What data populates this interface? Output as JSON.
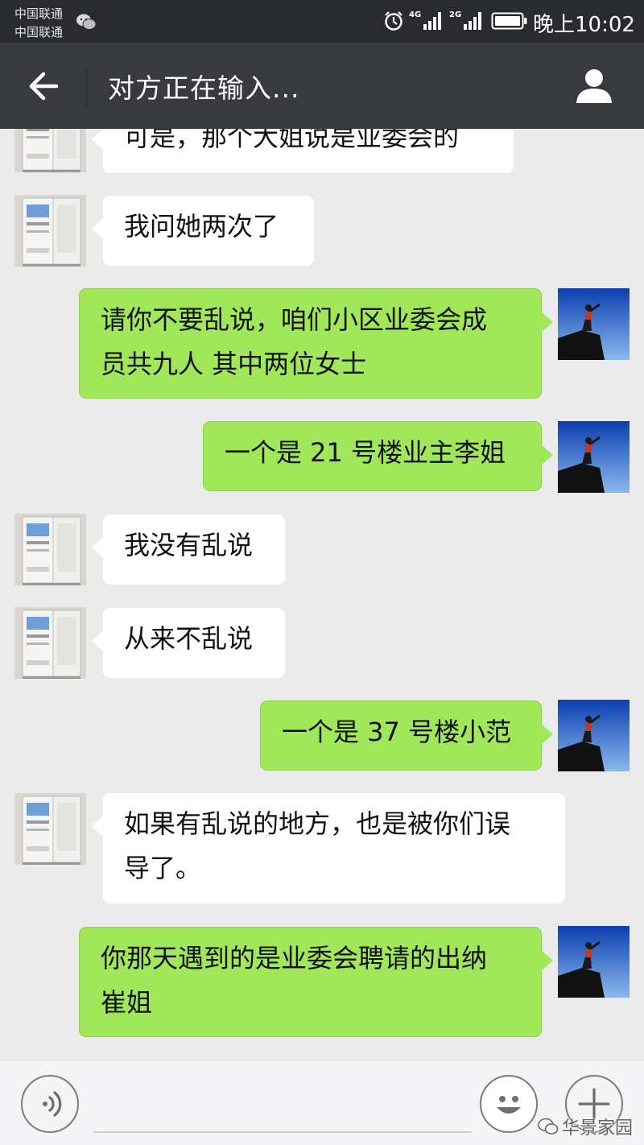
{
  "status_bar": {
    "carrier_1": "中国联通",
    "carrier_2": "中国联通",
    "network_1": "4G",
    "network_2": "2G",
    "time": "晚上10:02",
    "icons": [
      "wechat-icon",
      "alarm-icon",
      "signal-icon",
      "signal-icon",
      "battery-icon"
    ]
  },
  "nav": {
    "title": "对方正在输入...",
    "back_icon": "back-arrow-icon",
    "profile_icon": "person-icon"
  },
  "colors": {
    "status_bar": "#2a2b2f",
    "nav_bar": "#393a3e",
    "chat_background": "#ebebeb",
    "incoming_bubble": "#ffffff",
    "outgoing_bubble": "#a0e75a"
  },
  "contacts": {
    "other": {
      "avatar": "product-photo-avatar"
    },
    "me": {
      "avatar": "mountain-silhouette-avatar"
    }
  },
  "messages": [
    {
      "sender": "other",
      "lines": [
        "可是，那个大姐说是业委会的"
      ]
    },
    {
      "sender": "other",
      "lines": [
        "我问她两次了"
      ]
    },
    {
      "sender": "me",
      "lines": [
        "请你不要乱说，咱们小区业委会成",
        "员共九人 其中两位女士"
      ]
    },
    {
      "sender": "me",
      "lines": [
        "一个是 21 号楼业主李姐"
      ]
    },
    {
      "sender": "other",
      "lines": [
        "我没有乱说"
      ]
    },
    {
      "sender": "other",
      "lines": [
        "从来不乱说"
      ]
    },
    {
      "sender": "me",
      "lines": [
        "一个是 37 号楼小范"
      ]
    },
    {
      "sender": "other",
      "lines": [
        "如果有乱说的地方，也是被你们误",
        "导了。"
      ]
    },
    {
      "sender": "me",
      "lines": [
        "你那天遇到的是业委会聘请的出纳",
        "崔姐"
      ]
    }
  ],
  "input_bar": {
    "voice_icon": "voice-icon",
    "emoji_icon": "emoji-icon",
    "plus_icon": "plus-icon",
    "watermark": "华景家园"
  }
}
